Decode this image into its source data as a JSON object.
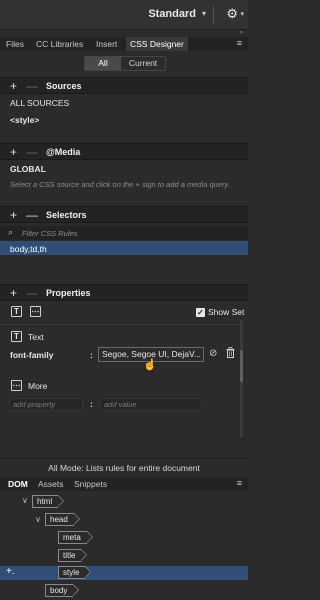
{
  "header": {
    "workspace": "Standard",
    "workspace_caret": "▾",
    "gear": "⚙",
    "gear_caret": "▾",
    "grip": "››"
  },
  "tabs": [
    {
      "label": "Files",
      "active": false
    },
    {
      "label": "CC Libraries",
      "active": false
    },
    {
      "label": "Insert",
      "active": false
    },
    {
      "label": "CSS Designer",
      "active": true
    }
  ],
  "tab_menu_icon": "≡",
  "filter_toggle": {
    "all": "All",
    "current": "Current",
    "selected": "All"
  },
  "sources": {
    "title": "Sources",
    "items": [
      "ALL SOURCES",
      "<style>"
    ]
  },
  "media": {
    "title": "@Media",
    "items": [
      "GLOBAL"
    ],
    "hint": "Select a CSS source and click on the + sign to add a media query."
  },
  "selectors": {
    "title": "Selectors",
    "filter_placeholder": "Filter CSS Rules",
    "items": [
      "body,td,th"
    ],
    "search_glyph": "⌕"
  },
  "properties": {
    "title": "Properties",
    "show_set_label": "Show Set",
    "show_set": true,
    "text_section": "Text",
    "text_icon": "T",
    "layout_icon": "T",
    "more_icon": "⋯",
    "property_name": "font-family",
    "property_sep": ":",
    "property_value": "Segoe, Segoe UI, DejaV...",
    "disable_glyph": "⊘",
    "delete_glyph": "🗑",
    "more_section": "More",
    "add_property_placeholder": "add property",
    "add_value_placeholder": "add value"
  },
  "footer_text": "All Mode: Lists rules for entire document",
  "dom_tabs": [
    {
      "label": "DOM",
      "active": true
    },
    {
      "label": "Assets",
      "active": false
    },
    {
      "label": "Snippets",
      "active": false
    }
  ],
  "dom_tree": [
    {
      "tag": "html",
      "expanded": true
    },
    {
      "tag": "head",
      "expanded": true
    },
    {
      "tag": "meta"
    },
    {
      "tag": "title"
    },
    {
      "tag": "style",
      "selected": true
    },
    {
      "tag": "body"
    }
  ],
  "dom_add_glyph": "+.",
  "colors": {
    "panel": "#2b2b2b",
    "header": "#232323",
    "selection": "#2f4f78",
    "text": "#e6e6e6"
  }
}
